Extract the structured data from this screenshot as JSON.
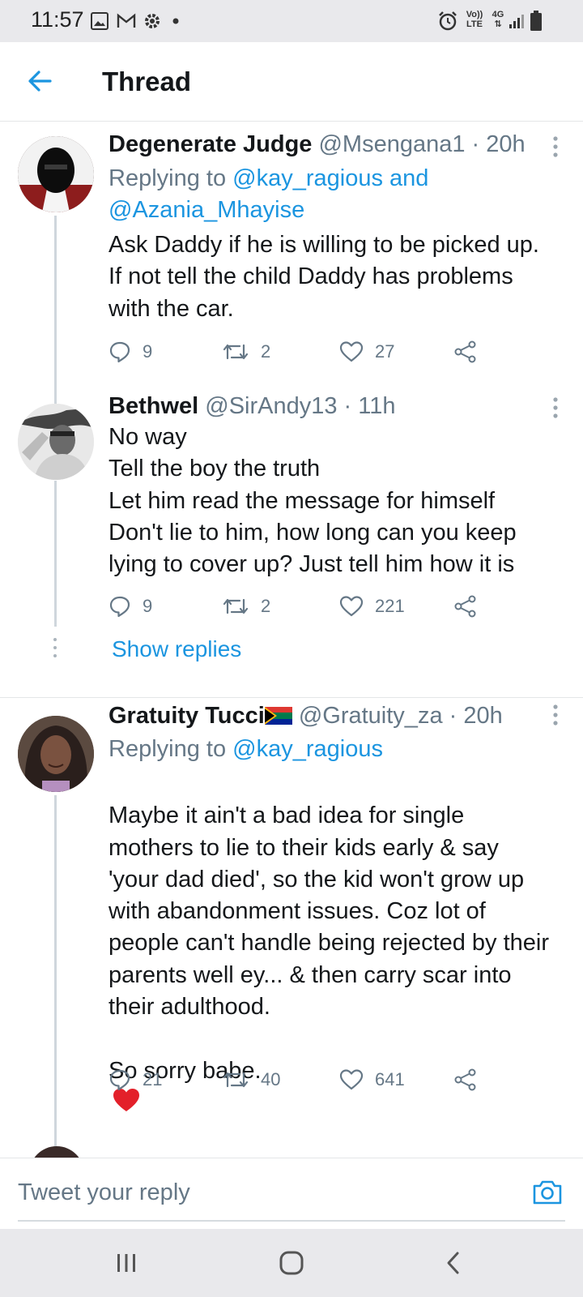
{
  "status_bar": {
    "time": "11:57",
    "left_icons": [
      "image-icon",
      "gmail-icon",
      "settings-icon",
      "dot-icon"
    ],
    "right_icons": [
      "alarm-icon",
      "volte-icon",
      "4g-icon",
      "signal-icon",
      "battery-icon"
    ],
    "volte_label_top": "Vo))",
    "volte_label_bottom": "LTE",
    "network_label": "4G"
  },
  "header": {
    "title": "Thread",
    "back_icon": "arrow-left-icon"
  },
  "tweets": [
    {
      "name": "Degenerate Judge",
      "handle": "@Msengana1 · 20h",
      "replying_prefix": "Replying to ",
      "replying_to_1": "@kay_ragious and",
      "replying_to_2": "@Azania_Mhayise",
      "text": "Ask Daddy if he is willing to be picked up.\nIf not tell the child Daddy has problems\nwith the car.",
      "replies": "9",
      "retweets": "2",
      "likes": "27"
    },
    {
      "name": "Bethwel",
      "handle": "@SirAndy13 · 11h",
      "text": "No way\nTell the boy the truth\nLet him read the message for himself\nDon't lie to him, how long can you keep\nlying to cover up? Just tell him how it is",
      "replies": "9",
      "retweets": "2",
      "likes": "221",
      "show_replies": "Show replies"
    },
    {
      "name": "Gratuity Tucci",
      "handle": "@Gratuity_za · 20h",
      "replying_prefix": "Replying to ",
      "replying_to_1": "@kay_ragious",
      "text": "Maybe it ain't a bad idea for single\nmothers to lie to their kids early & say\n'your dad died', so the kid won't grow up\nwith abandonment issues. Coz lot of\npeople can't handle being rejected by their\nparents well ey... & then carry scar into\ntheir adulthood.\n\nSo sorry babe.",
      "replies": "21",
      "retweets": "40",
      "likes": "641"
    }
  ],
  "composer": {
    "placeholder": "Tweet your reply",
    "camera_icon": "camera-icon"
  },
  "nav_bar": {
    "icons": [
      "recent-apps-icon",
      "home-icon",
      "back-icon"
    ]
  },
  "colors": {
    "accent": "#1b95e0",
    "secondary_text": "#657786",
    "primary_text": "#14171a",
    "system_bar": "#e9e9ec"
  }
}
